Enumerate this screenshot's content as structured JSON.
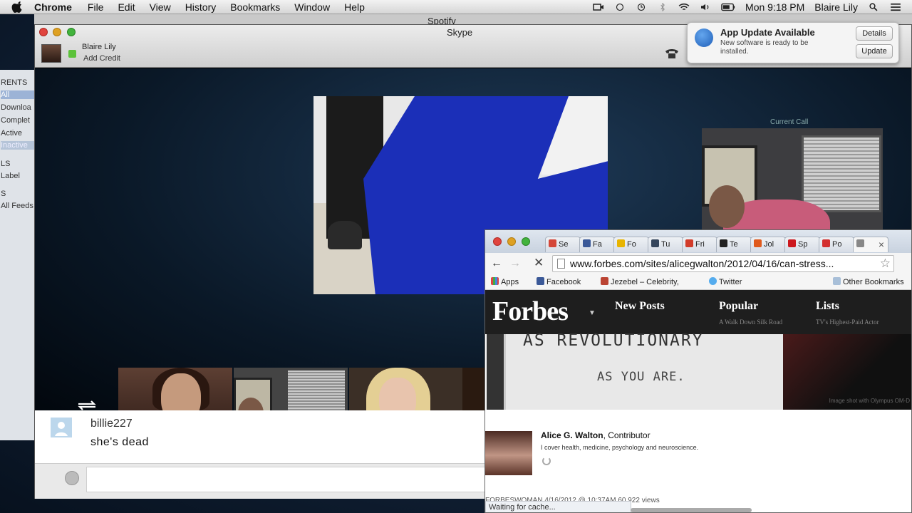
{
  "menubar": {
    "app": "Chrome",
    "menus": [
      "File",
      "Edit",
      "View",
      "History",
      "Bookmarks",
      "Window",
      "Help"
    ],
    "clock": "Mon 9:18 PM",
    "user": "Blaire Lily"
  },
  "sidebar_ghost": {
    "items": [
      "RENTS",
      "All",
      "Downloa",
      "Complet",
      "Active",
      "Inactive",
      "LS",
      "Label",
      "S",
      "All Feeds"
    ]
  },
  "spotify": {
    "title": "Spotify"
  },
  "skype": {
    "title": "Skype",
    "user_name": "Blaire Lily",
    "add_credit": "Add Credit",
    "current_call_label": "Current Call",
    "chat": {
      "user": "billie227",
      "message": "she's dead",
      "input_value": ""
    }
  },
  "notification": {
    "title": "App Update Available",
    "body": "New software is ready to be installed.",
    "details_label": "Details",
    "update_label": "Update"
  },
  "chrome": {
    "tabs": [
      {
        "label": "Se",
        "color": "#d44638"
      },
      {
        "label": "Fa",
        "color": "#3b5998"
      },
      {
        "label": "Fo",
        "color": "#e8b400"
      },
      {
        "label": "Tu",
        "color": "#35465c"
      },
      {
        "label": "Fri",
        "color": "#d23c2a"
      },
      {
        "label": "Te",
        "color": "#222222"
      },
      {
        "label": "Jol",
        "color": "#e05a1c"
      },
      {
        "label": "Sp",
        "color": "#cc181e"
      },
      {
        "label": "Po",
        "color": "#d32f2f"
      },
      {
        "label": "",
        "color": "#888888"
      }
    ],
    "url": "www.forbes.com/sites/alicegwalton/2012/04/16/can-stress...",
    "bookmarks": [
      "Apps",
      "Facebook",
      "Jezebel – Celebrity, ",
      "Twitter",
      "Other Bookmarks"
    ],
    "status": "Waiting for cache..."
  },
  "forbes": {
    "logo": "Forbes",
    "nav": [
      {
        "label": "New Posts",
        "sub": ""
      },
      {
        "label": "Popular",
        "sub": "A Walk Down Silk Road"
      },
      {
        "label": "Lists",
        "sub": "TV's Highest-Paid Actor"
      }
    ],
    "ad_line1": "AS REVOLUTIONARY",
    "ad_line2": "AS YOU ARE.",
    "ad_right_caption": "Image shot with Olympus OM-D",
    "author_name": "Alice G. Walton",
    "author_role": ", Contributor",
    "author_bio": "I cover health, medicine, psychology and neuroscience.",
    "meta": "FORBESWOMAN   4/16/2012 @ 10:37AM   60,922 views"
  }
}
